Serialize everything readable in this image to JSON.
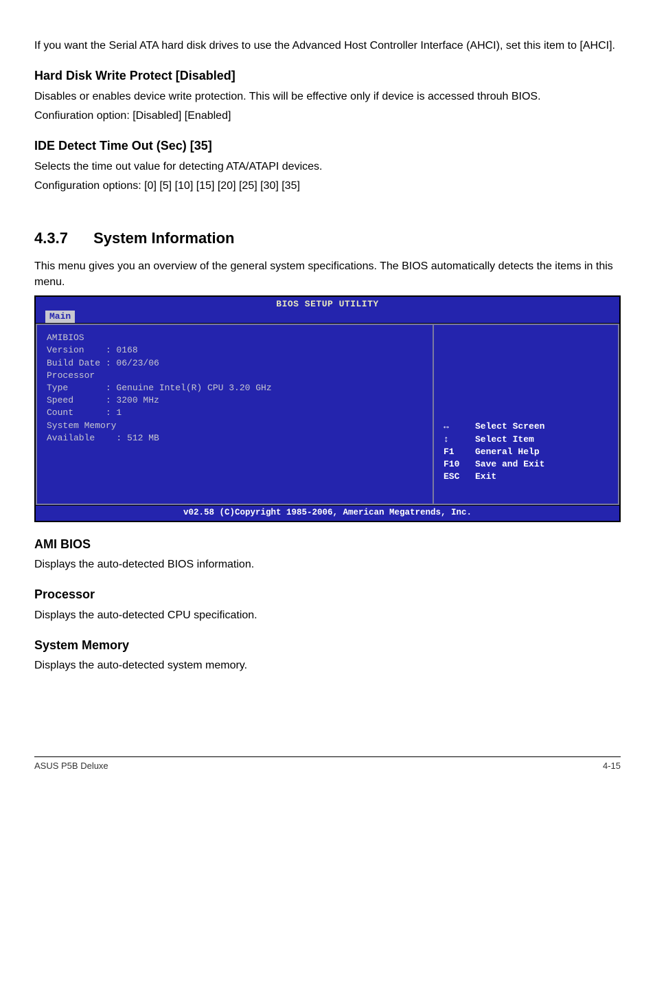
{
  "intro_para": "If you want the Serial ATA hard disk drives to use the Advanced Host Controller Interface (AHCI), set this item to [AHCI].",
  "sect1": {
    "heading": "Hard Disk Write Protect [Disabled]",
    "line1": "Disables or enables device write protection. This will be effective only if device is accessed throuh BIOS.",
    "line2": "Confiuration option: [Disabled] [Enabled]"
  },
  "sect2": {
    "heading": "IDE Detect Time Out (Sec) [35]",
    "line1": "Selects the time out value for detecting ATA/ATAPI devices.",
    "line2": "Configuration options: [0] [5] [10] [15] [20] [25] [30] [35]"
  },
  "sys_info": {
    "num": "4.3.7",
    "title": "System Information",
    "intro": "This menu gives you an overview of the general system specifications. The BIOS automatically detects the items in this menu."
  },
  "bios": {
    "title": "BIOS SETUP UTILITY",
    "tab": "Main",
    "left_lines": [
      "AMIBIOS",
      "Version    : 0168",
      "Build Date : 06/23/06",
      "",
      "Processor",
      "Type       : Genuine Intel(R) CPU 3.20 GHz",
      "Speed      : 3200 MHz",
      "Count      : 1",
      "",
      "System Memory",
      "Available    : 512 MB"
    ],
    "help_rows": [
      {
        "icon": "↔",
        "label": "Select Screen"
      },
      {
        "icon": "↕",
        "label": "Select Item"
      },
      {
        "icon": "F1",
        "label": "General Help"
      },
      {
        "icon": "F10",
        "label": "Save and Exit"
      },
      {
        "icon": "ESC",
        "label": "Exit"
      }
    ],
    "footer": "v02.58 (C)Copyright 1985-2006, American Megatrends, Inc."
  },
  "sub": {
    "ami_h": "AMI BIOS",
    "ami_t": "Displays the auto-detected BIOS information.",
    "proc_h": "Processor",
    "proc_t": "Displays the auto-detected CPU specification.",
    "mem_h": "System Memory",
    "mem_t": "Displays the auto-detected system memory."
  },
  "footer": {
    "left": "ASUS P5B Deluxe",
    "right": "4-15"
  }
}
